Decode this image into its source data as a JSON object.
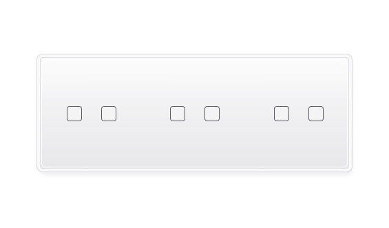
{
  "panel": {
    "color": "#efeff1",
    "key_border_color": "#5a5a60",
    "gangs": [
      {
        "keys": [
          "touch-key",
          "touch-key"
        ]
      },
      {
        "keys": [
          "touch-key",
          "touch-key"
        ]
      },
      {
        "keys": [
          "touch-key",
          "touch-key"
        ]
      }
    ]
  }
}
